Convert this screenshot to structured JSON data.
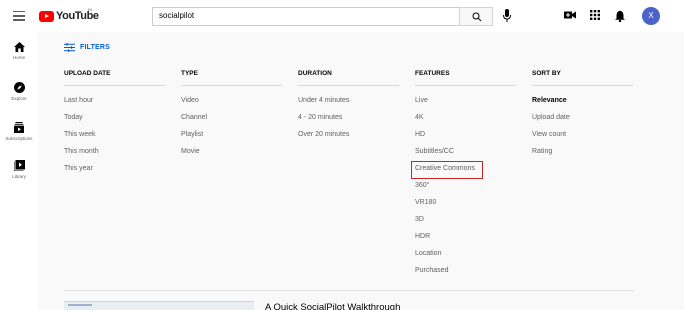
{
  "header": {
    "logo_text": "YouTube",
    "country_code": "IN",
    "search_value": "socialpilot",
    "avatar_letter": "X",
    "icons": [
      "menu-icon",
      "search-icon",
      "mic-icon",
      "create-video-icon",
      "apps-grid-icon",
      "bell-icon"
    ]
  },
  "guide": {
    "items": [
      {
        "label": "Home",
        "icon": "home-icon"
      },
      {
        "label": "Explore",
        "icon": "compass-icon"
      },
      {
        "label": "Subscriptions",
        "icon": "subscriptions-icon"
      },
      {
        "label": "Library",
        "icon": "library-icon"
      }
    ]
  },
  "filters": {
    "toggle_label": "FILTERS",
    "columns": [
      {
        "header": "UPLOAD DATE",
        "options": [
          "Last hour",
          "Today",
          "This week",
          "This month",
          "This year"
        ]
      },
      {
        "header": "TYPE",
        "options": [
          "Video",
          "Channel",
          "Playlist",
          "Movie"
        ]
      },
      {
        "header": "DURATION",
        "options": [
          "Under 4 minutes",
          "4 - 20 minutes",
          "Over 20 minutes"
        ]
      },
      {
        "header": "FEATURES",
        "options": [
          "Live",
          "4K",
          "HD",
          "Subtitles/CC",
          "Creative Commons",
          "360°",
          "VR180",
          "3D",
          "HDR",
          "Location",
          "Purchased"
        ]
      },
      {
        "header": "SORT BY",
        "options": [
          "Relevance",
          "Upload date",
          "View count",
          "Rating"
        ]
      }
    ],
    "selected_sort": "Relevance",
    "highlighted_feature": "Creative Commons",
    "highlight_color": "#c62828"
  },
  "results": {
    "first_video_title": "A Quick SocialPilot Walkthrough"
  },
  "colors": {
    "accent_blue": "#065fd4",
    "brand_red": "#ff0000",
    "avatar_bg": "#4d62c9"
  }
}
